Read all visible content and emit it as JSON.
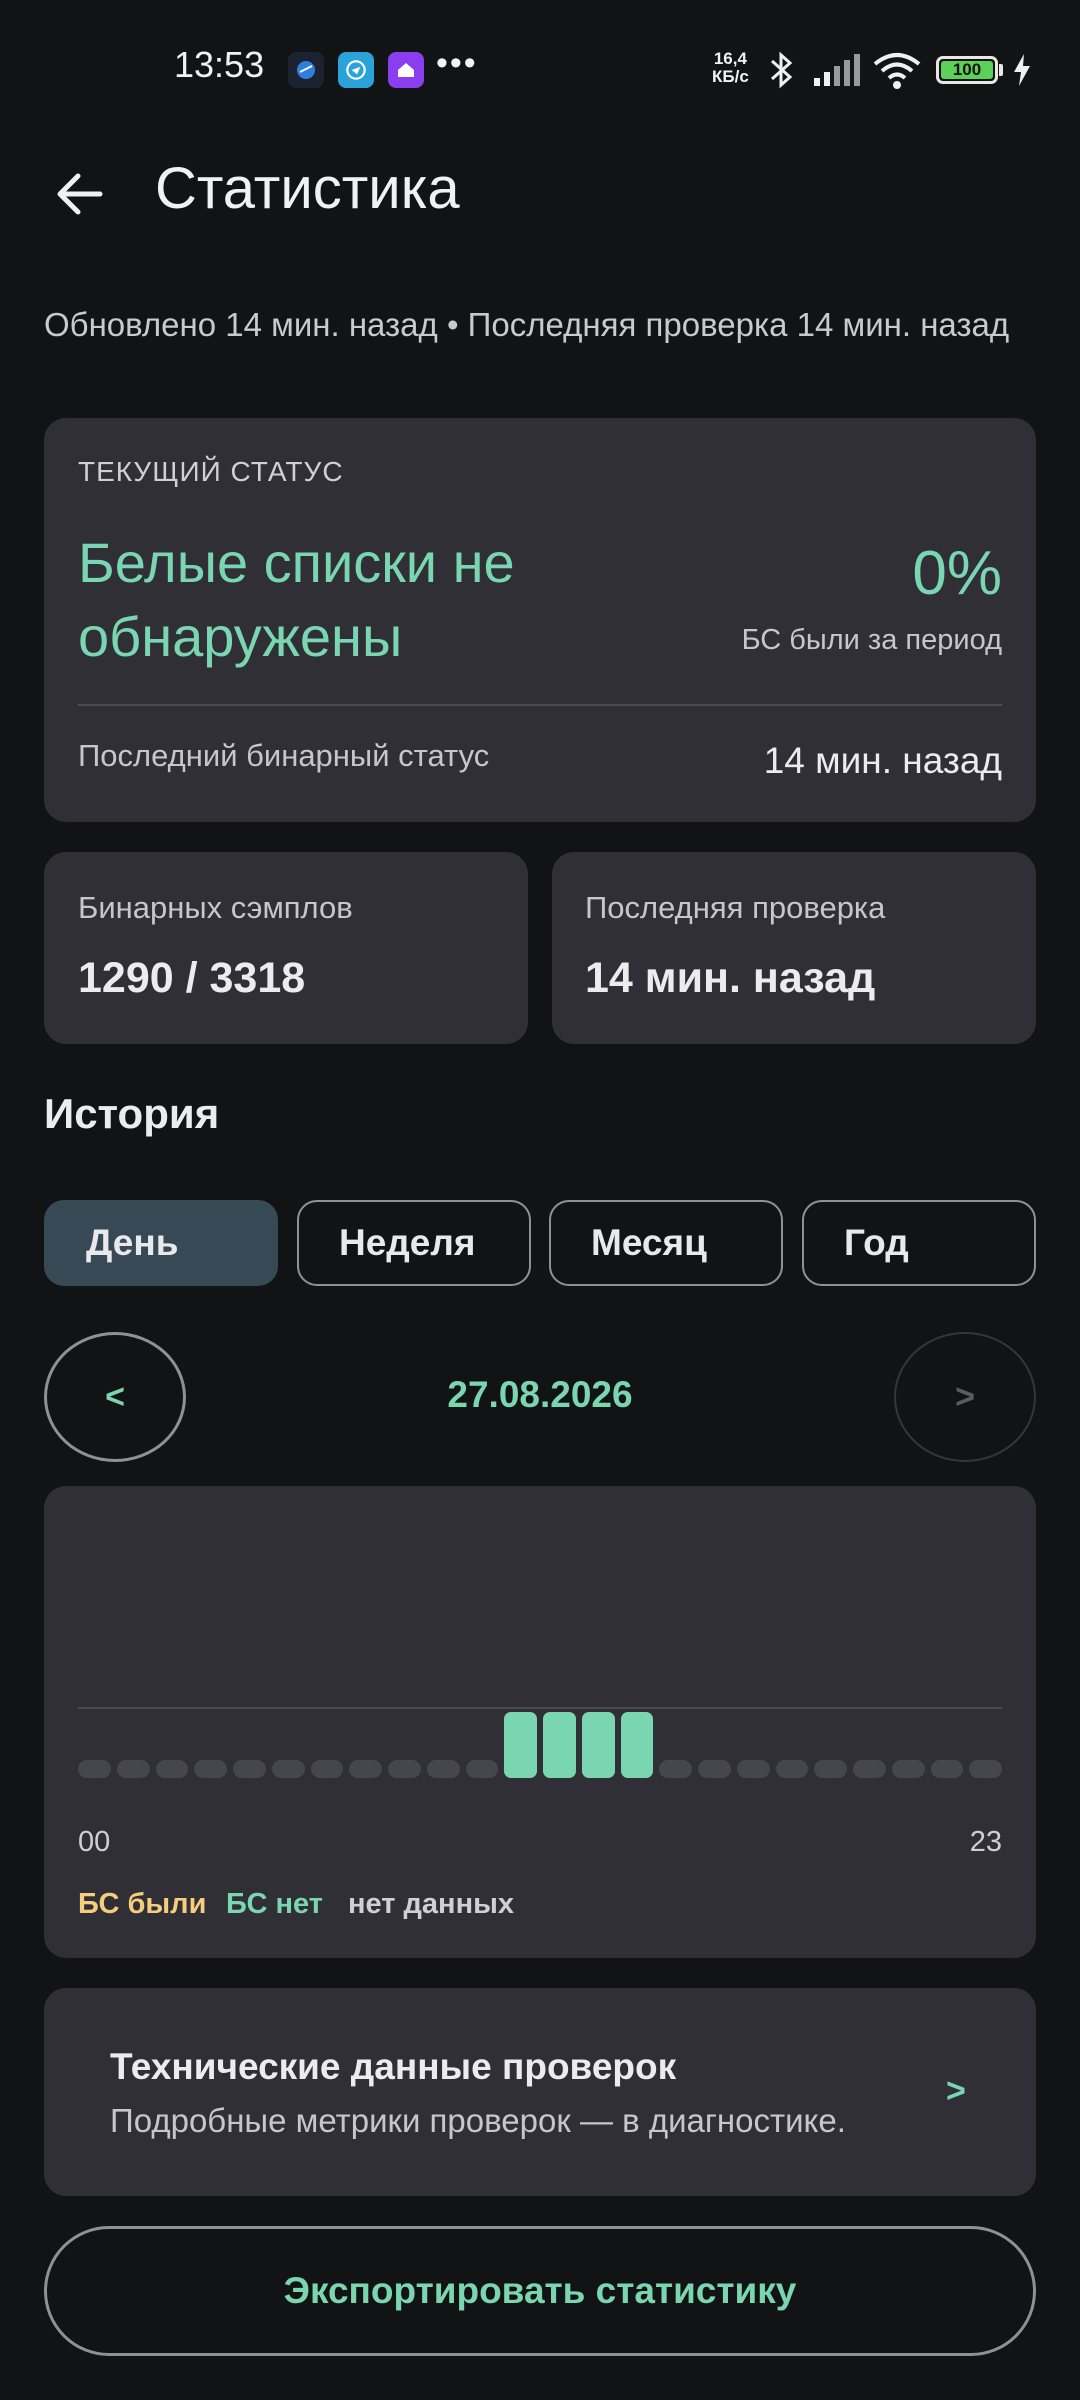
{
  "status_bar": {
    "time": "13:53",
    "dots": "•••",
    "net_speed_value": "16,4",
    "net_speed_unit": "КБ/с",
    "battery": "100",
    "icons": [
      "app-icon-blue-dark",
      "app-icon-telegram-like",
      "app-icon-purple-home",
      "bluetooth-icon",
      "signal-icon",
      "wifi-icon",
      "battery-icon",
      "charging-icon"
    ]
  },
  "header": {
    "title": "Статистика",
    "back_icon": "arrow-left-icon"
  },
  "updated_text": "Обновлено 14 мин. назад • Последняя проверка 14 мин. назад",
  "current_status": {
    "label": "ТЕКУЩИЙ СТАТУС",
    "main": "Белые списки не обнаружены",
    "percent": "0%",
    "percent_caption": "БС были за период",
    "last_binary_label": "Последний бинарный статус",
    "last_binary_value": "14 мин. назад"
  },
  "samples": {
    "label": "Бинарных сэмплов",
    "value": "1290 / 3318"
  },
  "last_check": {
    "label": "Последняя проверка",
    "value": "14 мин. назад"
  },
  "history": {
    "title": "История",
    "tabs": [
      {
        "label": "День",
        "active": true
      },
      {
        "label": "Неделя",
        "active": false
      },
      {
        "label": "Месяц",
        "active": false
      },
      {
        "label": "Год",
        "active": false
      }
    ],
    "prev": "<",
    "next": ">",
    "date": "27.08.2026"
  },
  "chart_data": {
    "type": "bar",
    "x_start_label": "00",
    "x_end_label": "23",
    "hours": [
      0,
      1,
      2,
      3,
      4,
      5,
      6,
      7,
      8,
      9,
      10,
      11,
      12,
      13,
      14,
      15,
      16,
      17,
      18,
      19,
      20,
      21,
      22,
      23
    ],
    "status": [
      "none",
      "none",
      "none",
      "none",
      "none",
      "none",
      "none",
      "none",
      "none",
      "none",
      "none",
      "no",
      "no",
      "no",
      "no",
      "none",
      "none",
      "none",
      "none",
      "none",
      "none",
      "none",
      "none",
      "none"
    ],
    "legend": [
      {
        "key": "yes",
        "label": "БС были",
        "color": "#f5cd7e"
      },
      {
        "key": "no",
        "label": "БС нет",
        "color": "#7ad6b1"
      },
      {
        "key": "none",
        "label": "нет данных",
        "color": "#d0d0d4"
      }
    ],
    "colors": {
      "yes": "#f5cd7e",
      "no": "#7ad6b1",
      "none": "#46464d"
    }
  },
  "tech": {
    "title": "Технические данные проверок",
    "subtitle": "Подробные метрики проверок — в диагностике.",
    "chevron": ">"
  },
  "export_label": "Экспортировать статистику",
  "colors": {
    "accent": "#7ad6b1",
    "background": "#111314",
    "card": "#2f2f35",
    "active_tab": "#364955"
  }
}
